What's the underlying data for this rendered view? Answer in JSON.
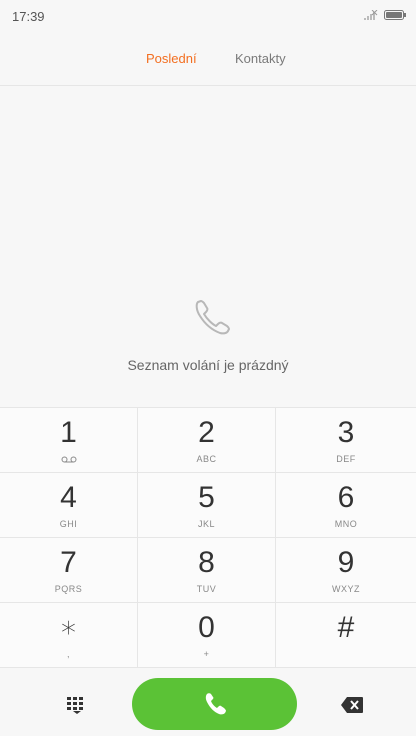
{
  "status_bar": {
    "time": "17:39",
    "icons": [
      "signal-icon",
      "battery-icon"
    ]
  },
  "tabs": [
    {
      "label": "Poslední",
      "active": true
    },
    {
      "label": "Kontakty",
      "active": false
    }
  ],
  "empty_state": {
    "icon": "phone-outline-icon",
    "message": "Seznam volání je prázdný"
  },
  "keypad": {
    "keys": [
      {
        "digit": "1",
        "letters": "",
        "sub_icon": "voicemail-icon"
      },
      {
        "digit": "2",
        "letters": "ABC"
      },
      {
        "digit": "3",
        "letters": "DEF"
      },
      {
        "digit": "4",
        "letters": "GHI"
      },
      {
        "digit": "5",
        "letters": "JKL"
      },
      {
        "digit": "6",
        "letters": "MNO"
      },
      {
        "digit": "7",
        "letters": "PQRS"
      },
      {
        "digit": "8",
        "letters": "TUV"
      },
      {
        "digit": "9",
        "letters": "WXYZ"
      },
      {
        "digit": "∗",
        "letters": ","
      },
      {
        "digit": "0",
        "letters": "+"
      },
      {
        "digit": "#",
        "letters": ""
      }
    ]
  },
  "bottom_bar": {
    "left_icon": "dialpad-icon",
    "call_icon": "phone-icon",
    "right_icon": "backspace-icon"
  },
  "colors": {
    "accent": "#f36f21",
    "call_green": "#5bc236",
    "background": "#f7f7f7",
    "divider": "#e6e6e6"
  }
}
